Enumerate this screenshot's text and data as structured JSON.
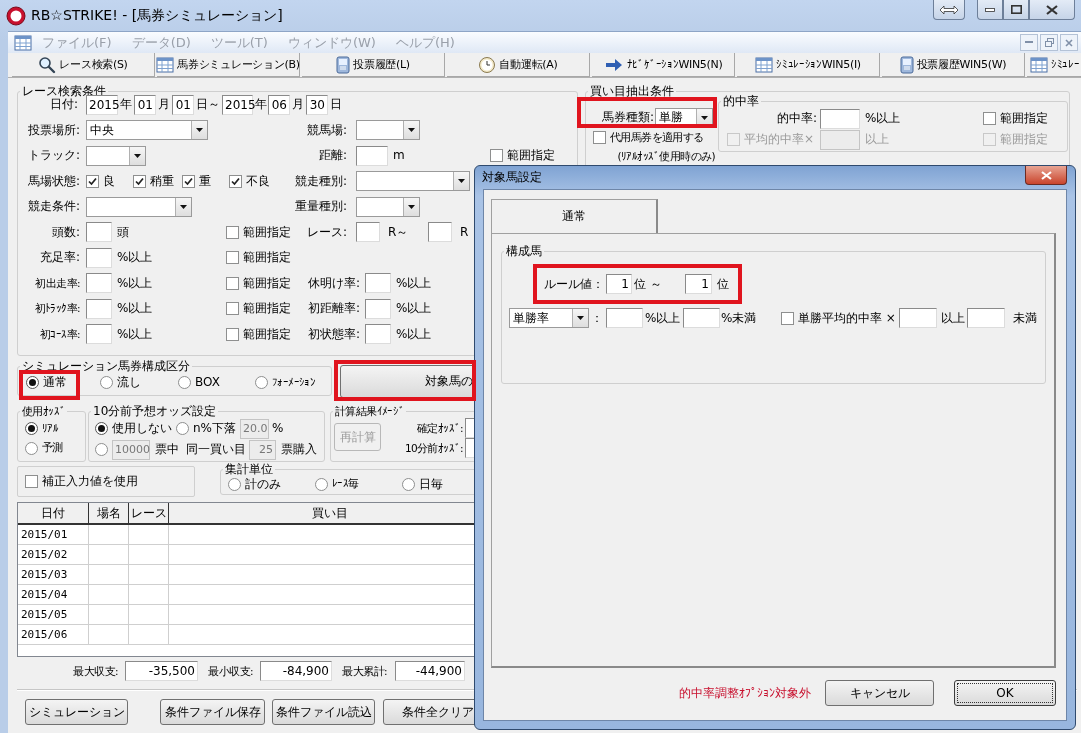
{
  "window": {
    "title": "RB☆STRIKE! - [馬券シミュレーション]"
  },
  "menu": [
    {
      "text": "ファイル(F)"
    },
    {
      "text": "データ(D)"
    },
    {
      "text": "ツール(T)"
    },
    {
      "text": "ウィンドウ(W)"
    },
    {
      "text": "ヘルプ(H)"
    }
  ],
  "toolbar": [
    {
      "text": "レース検索(S)"
    },
    {
      "text": "馬券シミュレーション(B)"
    },
    {
      "text": "投票履歴(L)"
    },
    {
      "text": "自動運転(A)"
    },
    {
      "text": "ﾅﾋﾞｹﾞｰｼｮﾝWIN5(N)"
    },
    {
      "text": "ｼﾐｭﾚｰｼｮﾝWIN5(I)"
    },
    {
      "text": "投票履歴WIN5(W)"
    },
    {
      "text": "ｼﾐｭﾚｰ"
    }
  ],
  "race_search": {
    "title": "レース検索条件",
    "rows": [
      {
        "items": [
          {
            "kind": "text",
            "text": "日付:"
          },
          {
            "kind": "field",
            "value": "2015"
          },
          {
            "kind": "text",
            "text": "年"
          },
          {
            "kind": "field",
            "value": "01"
          },
          {
            "kind": "text",
            "text": "月"
          },
          {
            "kind": "field",
            "value": "01"
          },
          {
            "kind": "text",
            "text": "日～"
          },
          {
            "kind": "field",
            "value": "2015"
          },
          {
            "kind": "text",
            "text": "年"
          },
          {
            "kind": "field",
            "value": "06"
          },
          {
            "kind": "text",
            "text": "月"
          },
          {
            "kind": "field",
            "value": "30"
          },
          {
            "kind": "text",
            "text": "日"
          }
        ]
      },
      {
        "items": [
          {
            "kind": "text",
            "text": "投票場所:"
          },
          {
            "kind": "combo",
            "value": "中央"
          },
          {
            "kind": "text",
            "text": "競馬場:"
          },
          {
            "kind": "combo"
          }
        ]
      },
      {
        "items": [
          {
            "kind": "text",
            "text": "トラック:"
          },
          {
            "kind": "combo"
          },
          {
            "kind": "text",
            "text": "距離:"
          },
          {
            "kind": "field"
          },
          {
            "kind": "text",
            "text": "m"
          },
          {
            "kind": "check",
            "text": "範囲指定",
            "checked": false
          }
        ]
      },
      {
        "items": [
          {
            "kind": "text",
            "text": "馬場状態:"
          },
          {
            "kind": "check",
            "text": "良",
            "checked": true
          },
          {
            "kind": "check",
            "text": "稍重",
            "checked": true
          },
          {
            "kind": "check",
            "text": "重",
            "checked": true
          },
          {
            "kind": "check",
            "text": "不良",
            "checked": true
          },
          {
            "kind": "text",
            "text": "競走種別:"
          },
          {
            "kind": "combo"
          }
        ]
      },
      {
        "items": [
          {
            "kind": "text",
            "text": "競走条件:"
          },
          {
            "kind": "combo"
          },
          {
            "kind": "text",
            "text": "重量種別:"
          },
          {
            "kind": "combo"
          }
        ]
      },
      {
        "items": [
          {
            "kind": "text",
            "text": "頭数:"
          },
          {
            "kind": "field"
          },
          {
            "kind": "text",
            "text": "頭"
          },
          {
            "kind": "check",
            "text": "範囲指定",
            "checked": false
          },
          {
            "kind": "text",
            "text": "レース:"
          },
          {
            "kind": "field"
          },
          {
            "kind": "text",
            "text": "R～"
          },
          {
            "kind": "field"
          },
          {
            "kind": "text",
            "text": "R"
          }
        ]
      },
      {
        "items": [
          {
            "kind": "text",
            "text": "充足率:"
          },
          {
            "kind": "field"
          },
          {
            "kind": "text",
            "text": "%以上"
          },
          {
            "kind": "check",
            "text": "範囲指定",
            "checked": false
          }
        ]
      },
      {
        "items": [
          {
            "kind": "text",
            "text": "初出走率:"
          },
          {
            "kind": "field"
          },
          {
            "kind": "text",
            "text": "%以上"
          },
          {
            "kind": "check",
            "text": "範囲指定",
            "checked": false
          },
          {
            "kind": "text",
            "text": "休明け率:"
          },
          {
            "kind": "field"
          },
          {
            "kind": "text",
            "text": "%以上"
          }
        ]
      },
      {
        "items": [
          {
            "kind": "text",
            "text": "初ﾄﾗｯｸ率:"
          },
          {
            "kind": "field"
          },
          {
            "kind": "text",
            "text": "%以上"
          },
          {
            "kind": "check",
            "text": "範囲指定",
            "checked": false
          },
          {
            "kind": "text",
            "text": "初距離率:"
          },
          {
            "kind": "field"
          },
          {
            "kind": "text",
            "text": "%以上"
          }
        ]
      },
      {
        "items": [
          {
            "kind": "text",
            "text": "初ｺｰｽ率:"
          },
          {
            "kind": "field"
          },
          {
            "kind": "text",
            "text": "%以上"
          },
          {
            "kind": "check",
            "text": "範囲指定",
            "checked": false
          },
          {
            "kind": "text",
            "text": "初状態率:"
          },
          {
            "kind": "field"
          },
          {
            "kind": "text",
            "text": "%以上"
          }
        ]
      }
    ]
  },
  "buy_conditions": {
    "title": "買い目抽出条件",
    "rows": [
      {
        "items": [
          {
            "kind": "text",
            "text": "馬券種類:"
          },
          {
            "kind": "combo",
            "value": "単勝"
          }
        ]
      },
      {
        "items": [
          {
            "kind": "check",
            "text": "代用馬券を適用する",
            "checked": false
          }
        ]
      },
      {
        "items": [
          {
            "kind": "text",
            "text": "(ﾘｱﾙｵｯｽﾞ使用時のみ)"
          }
        ]
      }
    ],
    "hit_rate": {
      "title": "的中率",
      "rows": [
        {
          "items": [
            {
              "kind": "text",
              "text": "的中率:",
              "disabled": false
            },
            {
              "kind": "field",
              "disabled": false
            },
            {
              "kind": "text",
              "text": "%以上",
              "disabled": false
            },
            {
              "kind": "check",
              "text": "範囲指定",
              "checked": false,
              "disabled": false
            }
          ]
        },
        {
          "items": [
            {
              "kind": "check",
              "text": "平均的中率×",
              "checked": false,
              "disabled": true
            },
            {
              "kind": "field",
              "disabled": true
            },
            {
              "kind": "text",
              "text": "以上",
              "disabled": true
            },
            {
              "kind": "check",
              "text": "範囲指定",
              "checked": false,
              "disabled": true
            }
          ]
        }
      ]
    }
  },
  "composition": {
    "title": "シミュレーション馬券構成区分",
    "options": [
      {
        "kind": "radio",
        "text": "通常",
        "selected": true
      },
      {
        "kind": "radio",
        "text": "流し",
        "selected": false
      },
      {
        "kind": "radio",
        "text": "BOX",
        "selected": false
      },
      {
        "kind": "radio",
        "text": "ﾌｫｰﾒｰｼｮﾝ",
        "selected": false
      }
    ]
  },
  "target_button": {
    "text": "対象馬の"
  },
  "odds_source": {
    "title": "使用ｵｯｽﾞ",
    "options": [
      {
        "kind": "radio",
        "text": "ﾘｱﾙ",
        "selected": true
      },
      {
        "kind": "radio",
        "text": "予測",
        "selected": false
      }
    ]
  },
  "pre_odds": {
    "title": "10分前予想オッズ設定",
    "rows": [
      {
        "items": [
          {
            "kind": "radio",
            "text": "使用しない",
            "selected": true
          },
          {
            "kind": "radio",
            "text": "n%下落",
            "selected": false
          },
          {
            "kind": "field",
            "value": "20.0",
            "disabled": true
          },
          {
            "kind": "text",
            "text": "%"
          }
        ]
      },
      {
        "items": [
          {
            "kind": "radio",
            "selected": false
          },
          {
            "kind": "field",
            "value": "10000",
            "disabled": true
          },
          {
            "kind": "text",
            "text": "票中"
          },
          {
            "kind": "text",
            "text": "同一買い目"
          },
          {
            "kind": "field",
            "value": "25",
            "disabled": true
          },
          {
            "kind": "text",
            "text": "票購入"
          }
        ]
      }
    ]
  },
  "calc_image": {
    "title": "計算結果ｲﾒｰｼﾞ",
    "button": {
      "text": "再計算",
      "disabled": true
    },
    "rows": [
      {
        "items": [
          {
            "kind": "text",
            "text": "確定ｵｯｽﾞ:"
          },
          {
            "kind": "field"
          }
        ]
      },
      {
        "items": [
          {
            "kind": "text",
            "text": "10分前ｵｯｽﾞ:"
          },
          {
            "kind": "field"
          }
        ]
      }
    ]
  },
  "correction": {
    "kind": "check",
    "text": "補正入力値を使用",
    "checked": false
  },
  "aggregate": {
    "title": "集計単位",
    "options": [
      {
        "kind": "radio",
        "text": "計のみ",
        "selected": false
      },
      {
        "kind": "radio",
        "text": "ﾚｰｽ毎",
        "selected": false
      },
      {
        "kind": "radio",
        "text": "日毎",
        "selected": false
      }
    ]
  },
  "table": {
    "columns": [
      "日付",
      "場名",
      "レース",
      "買い目"
    ],
    "rows": [
      [
        "2015/01"
      ],
      [
        "2015/02"
      ],
      [
        "2015/03"
      ],
      [
        "2015/04"
      ],
      [
        "2015/05"
      ],
      [
        "2015/06"
      ]
    ]
  },
  "stats": [
    {
      "label": "最大収支:",
      "value": "-35,500"
    },
    {
      "label": "最小収支:",
      "value": "-84,900"
    },
    {
      "label": "最大累計:",
      "value": "-44,900"
    }
  ],
  "actions": [
    {
      "text": "シミュレーション"
    },
    {
      "text": "条件ファイル保存"
    },
    {
      "text": "条件ファイル読込"
    },
    {
      "text": "条件全クリア"
    }
  ],
  "dialog": {
    "title": "対象馬設定",
    "tabs": [
      {
        "text": "通常",
        "selected": true
      }
    ],
    "group": {
      "title": "構成馬",
      "rows": [
        {
          "items": [
            {
              "kind": "text",
              "text": "ルール値："
            },
            {
              "kind": "field",
              "value": "1"
            },
            {
              "kind": "text",
              "text": "位 ～"
            },
            {
              "kind": "field",
              "value": "1"
            },
            {
              "kind": "text",
              "text": "位"
            }
          ]
        },
        {
          "items": [
            {
              "kind": "combo",
              "value": "単勝率"
            },
            {
              "kind": "text",
              "text": "："
            },
            {
              "kind": "field"
            },
            {
              "kind": "text",
              "text": "%以上"
            },
            {
              "kind": "field"
            },
            {
              "kind": "text",
              "text": "%未満"
            },
            {
              "kind": "check",
              "text": "単勝平均的中率 ×",
              "checked": false
            },
            {
              "kind": "field"
            },
            {
              "kind": "text",
              "text": "以上"
            },
            {
              "kind": "field"
            },
            {
              "kind": "text",
              "text": "未満"
            }
          ]
        }
      ]
    },
    "note": "的中率調整ｵﾌﾟｼｮﾝ対象外",
    "buttons": [
      {
        "text": "キャンセル",
        "default": false
      },
      {
        "text": "OK",
        "default": true
      }
    ]
  }
}
